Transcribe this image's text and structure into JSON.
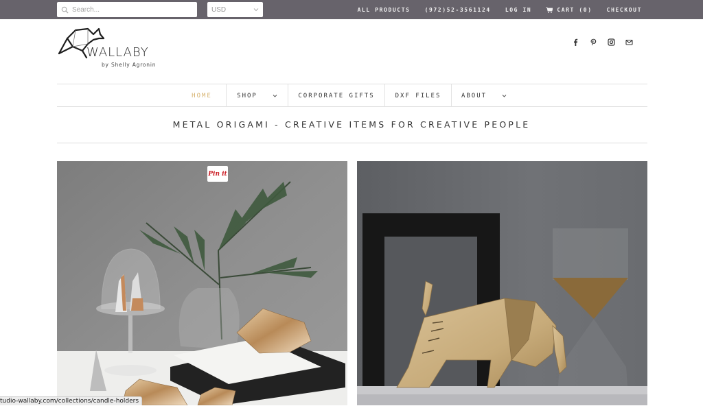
{
  "topbar": {
    "search_placeholder": "Search...",
    "currency": "USD",
    "links": {
      "all_products": "ALL PRODUCTS",
      "phone": "(972)52-3561124",
      "login": "LOG IN",
      "cart": "CART (0)",
      "checkout": "CHECKOUT"
    }
  },
  "header": {
    "brand": "WALLABY",
    "byline": "by Shelly Agronin",
    "social_icons": [
      "facebook-icon",
      "pinterest-icon",
      "instagram-icon",
      "email-icon"
    ]
  },
  "nav": {
    "items": [
      {
        "label": "HOME",
        "active": true
      },
      {
        "label": "SHOP",
        "dropdown": true
      },
      {
        "label": "CORPORATE GIFTS"
      },
      {
        "label": "DXF FILES"
      },
      {
        "label": "ABOUT",
        "dropdown": true
      }
    ]
  },
  "main": {
    "tagline": "METAL ORIGAMI - CREATIVE ITEMS FOR CREATIVE PEOPLE",
    "pin_label": "Pin it",
    "tiles": [
      {
        "alt": "Candle holders collection photo"
      },
      {
        "alt": "Origami bull sculpture photo"
      }
    ]
  },
  "status_bar": {
    "url": "tudio-wallaby.com/collections/candle-holders"
  },
  "colors": {
    "topbar": "#67636b",
    "nav_active": "#d6b26e",
    "pin_red": "#cb2027"
  }
}
